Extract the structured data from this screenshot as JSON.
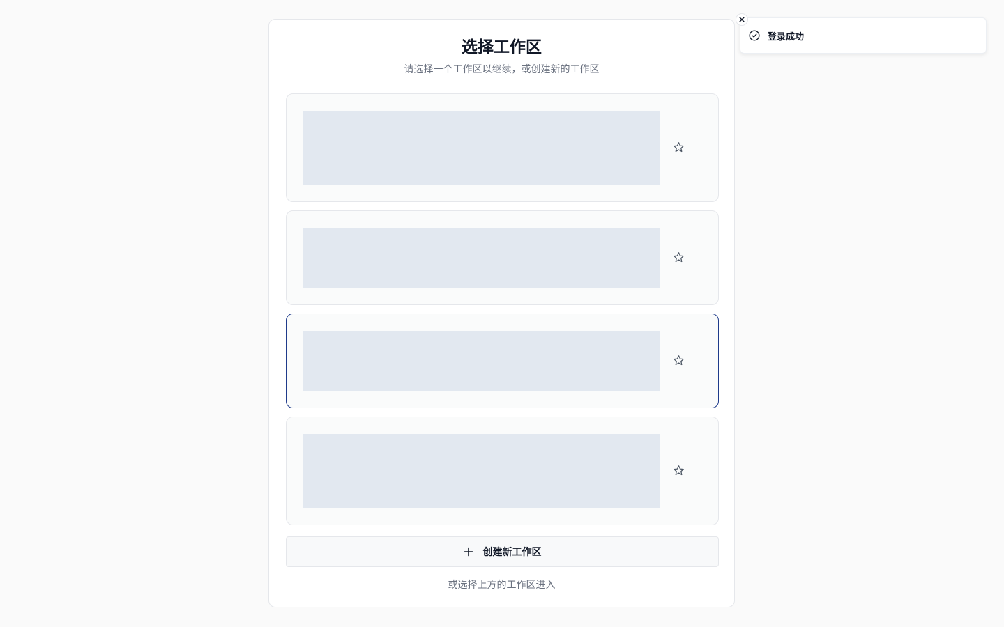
{
  "panel": {
    "title": "选择工作区",
    "subtitle": "请选择一个工作区以继续，或创建新的工作区",
    "workspaces": [
      {
        "state": "loading",
        "favorite": false,
        "selected": false
      },
      {
        "state": "loading",
        "favorite": false,
        "selected": false
      },
      {
        "state": "loading",
        "favorite": false,
        "selected": true
      },
      {
        "state": "loading",
        "favorite": false,
        "selected": false
      }
    ],
    "create_label": "创建新工作区",
    "hint": "或选择上方的工作区进入"
  },
  "toast": {
    "message": "登录成功",
    "icon": "check-circle-icon",
    "close_icon": "close-icon"
  },
  "colors": {
    "selected_border": "#1e3a8a",
    "skeleton": "#e2e8f0",
    "muted_text": "#6b7280"
  }
}
